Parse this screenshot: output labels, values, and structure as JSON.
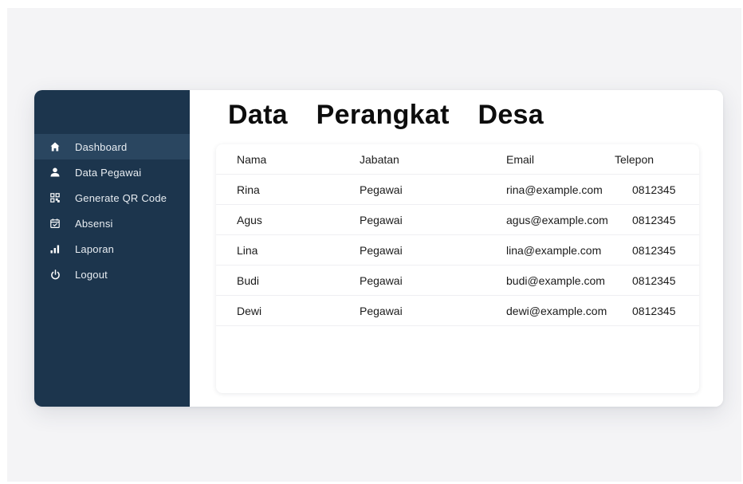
{
  "sidebar": {
    "items": [
      {
        "label": "Dashboard",
        "icon": "home-icon",
        "active": true
      },
      {
        "label": "Data Pegawai",
        "icon": "user-icon",
        "active": false
      },
      {
        "label": "Generate QR Code",
        "icon": "qr-code-icon",
        "active": false
      },
      {
        "label": "Absensi",
        "icon": "calendar-icon",
        "active": false
      },
      {
        "label": "Laporan",
        "icon": "bar-chart-icon",
        "active": false
      },
      {
        "label": "Logout",
        "icon": "power-icon",
        "active": false
      }
    ]
  },
  "main": {
    "title": "Data Perangkat Desa",
    "table": {
      "columns": [
        "Nama",
        "Jabatan",
        "Email",
        "Telepon"
      ],
      "rows": [
        [
          "Rina",
          "Pegawai",
          "rina@example.com",
          "0812345"
        ],
        [
          "Agus",
          "Pegawai",
          "agus@example.com",
          "0812345"
        ],
        [
          "Lina",
          "Pegawai",
          "lina@example.com",
          "0812345"
        ],
        [
          "Budi",
          "Pegawai",
          "budi@example.com",
          "0812345"
        ],
        [
          "Dewi",
          "Pegawai",
          "dewi@example.com",
          "0812345"
        ]
      ]
    }
  },
  "colors": {
    "sidebar_bg": "#1c354d",
    "sidebar_active": "#2a4660",
    "sidebar_text": "#e8edf2"
  }
}
